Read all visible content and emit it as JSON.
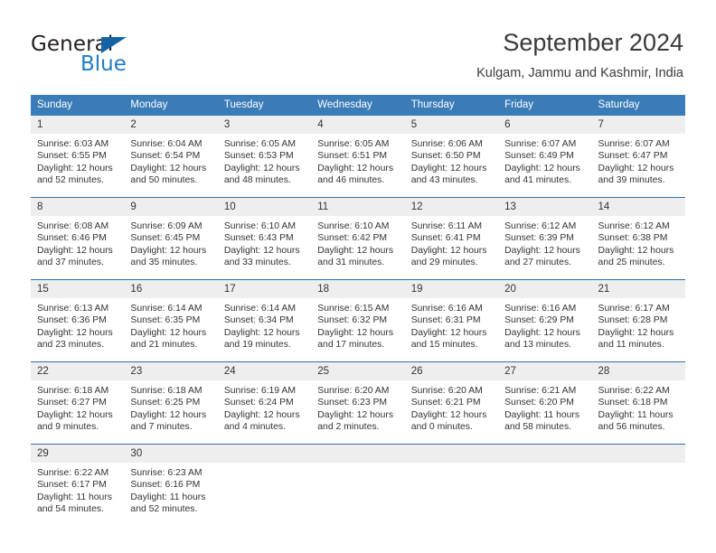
{
  "brand": {
    "name_top": "General",
    "name_bottom": "Blue",
    "accent_color": "#1f7bc4",
    "triangle_color": "#1464a5"
  },
  "header": {
    "title": "September 2024",
    "subtitle": "Kulgam, Jammu and Kashmir, India"
  },
  "theme": {
    "header_row_bg": "#3a7cb8",
    "daynum_bg": "#eeeeee",
    "row_divider": "#2f6fa8",
    "text": "#333333"
  },
  "weekdays": [
    "Sunday",
    "Monday",
    "Tuesday",
    "Wednesday",
    "Thursday",
    "Friday",
    "Saturday"
  ],
  "labels": {
    "sunrise_prefix": "Sunrise:",
    "sunset_prefix": "Sunset:",
    "daylight_prefix": "Daylight:"
  },
  "weeks": [
    [
      {
        "day": "1",
        "sunrise": "Sunrise: 6:03 AM",
        "sunset": "Sunset: 6:55 PM",
        "daylight_1": "Daylight: 12 hours",
        "daylight_2": "and 52 minutes."
      },
      {
        "day": "2",
        "sunrise": "Sunrise: 6:04 AM",
        "sunset": "Sunset: 6:54 PM",
        "daylight_1": "Daylight: 12 hours",
        "daylight_2": "and 50 minutes."
      },
      {
        "day": "3",
        "sunrise": "Sunrise: 6:05 AM",
        "sunset": "Sunset: 6:53 PM",
        "daylight_1": "Daylight: 12 hours",
        "daylight_2": "and 48 minutes."
      },
      {
        "day": "4",
        "sunrise": "Sunrise: 6:05 AM",
        "sunset": "Sunset: 6:51 PM",
        "daylight_1": "Daylight: 12 hours",
        "daylight_2": "and 46 minutes."
      },
      {
        "day": "5",
        "sunrise": "Sunrise: 6:06 AM",
        "sunset": "Sunset: 6:50 PM",
        "daylight_1": "Daylight: 12 hours",
        "daylight_2": "and 43 minutes."
      },
      {
        "day": "6",
        "sunrise": "Sunrise: 6:07 AM",
        "sunset": "Sunset: 6:49 PM",
        "daylight_1": "Daylight: 12 hours",
        "daylight_2": "and 41 minutes."
      },
      {
        "day": "7",
        "sunrise": "Sunrise: 6:07 AM",
        "sunset": "Sunset: 6:47 PM",
        "daylight_1": "Daylight: 12 hours",
        "daylight_2": "and 39 minutes."
      }
    ],
    [
      {
        "day": "8",
        "sunrise": "Sunrise: 6:08 AM",
        "sunset": "Sunset: 6:46 PM",
        "daylight_1": "Daylight: 12 hours",
        "daylight_2": "and 37 minutes."
      },
      {
        "day": "9",
        "sunrise": "Sunrise: 6:09 AM",
        "sunset": "Sunset: 6:45 PM",
        "daylight_1": "Daylight: 12 hours",
        "daylight_2": "and 35 minutes."
      },
      {
        "day": "10",
        "sunrise": "Sunrise: 6:10 AM",
        "sunset": "Sunset: 6:43 PM",
        "daylight_1": "Daylight: 12 hours",
        "daylight_2": "and 33 minutes."
      },
      {
        "day": "11",
        "sunrise": "Sunrise: 6:10 AM",
        "sunset": "Sunset: 6:42 PM",
        "daylight_1": "Daylight: 12 hours",
        "daylight_2": "and 31 minutes."
      },
      {
        "day": "12",
        "sunrise": "Sunrise: 6:11 AM",
        "sunset": "Sunset: 6:41 PM",
        "daylight_1": "Daylight: 12 hours",
        "daylight_2": "and 29 minutes."
      },
      {
        "day": "13",
        "sunrise": "Sunrise: 6:12 AM",
        "sunset": "Sunset: 6:39 PM",
        "daylight_1": "Daylight: 12 hours",
        "daylight_2": "and 27 minutes."
      },
      {
        "day": "14",
        "sunrise": "Sunrise: 6:12 AM",
        "sunset": "Sunset: 6:38 PM",
        "daylight_1": "Daylight: 12 hours",
        "daylight_2": "and 25 minutes."
      }
    ],
    [
      {
        "day": "15",
        "sunrise": "Sunrise: 6:13 AM",
        "sunset": "Sunset: 6:36 PM",
        "daylight_1": "Daylight: 12 hours",
        "daylight_2": "and 23 minutes."
      },
      {
        "day": "16",
        "sunrise": "Sunrise: 6:14 AM",
        "sunset": "Sunset: 6:35 PM",
        "daylight_1": "Daylight: 12 hours",
        "daylight_2": "and 21 minutes."
      },
      {
        "day": "17",
        "sunrise": "Sunrise: 6:14 AM",
        "sunset": "Sunset: 6:34 PM",
        "daylight_1": "Daylight: 12 hours",
        "daylight_2": "and 19 minutes."
      },
      {
        "day": "18",
        "sunrise": "Sunrise: 6:15 AM",
        "sunset": "Sunset: 6:32 PM",
        "daylight_1": "Daylight: 12 hours",
        "daylight_2": "and 17 minutes."
      },
      {
        "day": "19",
        "sunrise": "Sunrise: 6:16 AM",
        "sunset": "Sunset: 6:31 PM",
        "daylight_1": "Daylight: 12 hours",
        "daylight_2": "and 15 minutes."
      },
      {
        "day": "20",
        "sunrise": "Sunrise: 6:16 AM",
        "sunset": "Sunset: 6:29 PM",
        "daylight_1": "Daylight: 12 hours",
        "daylight_2": "and 13 minutes."
      },
      {
        "day": "21",
        "sunrise": "Sunrise: 6:17 AM",
        "sunset": "Sunset: 6:28 PM",
        "daylight_1": "Daylight: 12 hours",
        "daylight_2": "and 11 minutes."
      }
    ],
    [
      {
        "day": "22",
        "sunrise": "Sunrise: 6:18 AM",
        "sunset": "Sunset: 6:27 PM",
        "daylight_1": "Daylight: 12 hours",
        "daylight_2": "and 9 minutes."
      },
      {
        "day": "23",
        "sunrise": "Sunrise: 6:18 AM",
        "sunset": "Sunset: 6:25 PM",
        "daylight_1": "Daylight: 12 hours",
        "daylight_2": "and 7 minutes."
      },
      {
        "day": "24",
        "sunrise": "Sunrise: 6:19 AM",
        "sunset": "Sunset: 6:24 PM",
        "daylight_1": "Daylight: 12 hours",
        "daylight_2": "and 4 minutes."
      },
      {
        "day": "25",
        "sunrise": "Sunrise: 6:20 AM",
        "sunset": "Sunset: 6:23 PM",
        "daylight_1": "Daylight: 12 hours",
        "daylight_2": "and 2 minutes."
      },
      {
        "day": "26",
        "sunrise": "Sunrise: 6:20 AM",
        "sunset": "Sunset: 6:21 PM",
        "daylight_1": "Daylight: 12 hours",
        "daylight_2": "and 0 minutes."
      },
      {
        "day": "27",
        "sunrise": "Sunrise: 6:21 AM",
        "sunset": "Sunset: 6:20 PM",
        "daylight_1": "Daylight: 11 hours",
        "daylight_2": "and 58 minutes."
      },
      {
        "day": "28",
        "sunrise": "Sunrise: 6:22 AM",
        "sunset": "Sunset: 6:18 PM",
        "daylight_1": "Daylight: 11 hours",
        "daylight_2": "and 56 minutes."
      }
    ],
    [
      {
        "day": "29",
        "sunrise": "Sunrise: 6:22 AM",
        "sunset": "Sunset: 6:17 PM",
        "daylight_1": "Daylight: 11 hours",
        "daylight_2": "and 54 minutes."
      },
      {
        "day": "30",
        "sunrise": "Sunrise: 6:23 AM",
        "sunset": "Sunset: 6:16 PM",
        "daylight_1": "Daylight: 11 hours",
        "daylight_2": "and 52 minutes."
      },
      {
        "day": "",
        "sunrise": "",
        "sunset": "",
        "daylight_1": "",
        "daylight_2": ""
      },
      {
        "day": "",
        "sunrise": "",
        "sunset": "",
        "daylight_1": "",
        "daylight_2": ""
      },
      {
        "day": "",
        "sunrise": "",
        "sunset": "",
        "daylight_1": "",
        "daylight_2": ""
      },
      {
        "day": "",
        "sunrise": "",
        "sunset": "",
        "daylight_1": "",
        "daylight_2": ""
      },
      {
        "day": "",
        "sunrise": "",
        "sunset": "",
        "daylight_1": "",
        "daylight_2": ""
      }
    ]
  ]
}
